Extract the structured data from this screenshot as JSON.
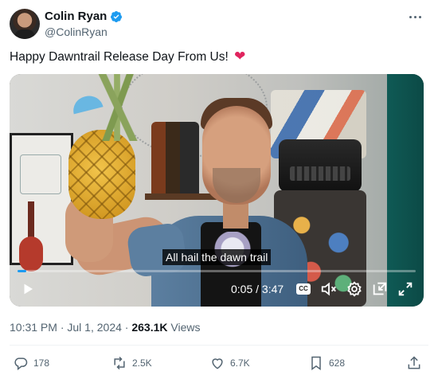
{
  "author": {
    "name": "Colin Ryan",
    "handle": "@ColinRyan",
    "verified": true
  },
  "tweet": {
    "text": "Happy Dawntrail Release Day From Us!",
    "emoji": "❤"
  },
  "video": {
    "caption": "All hail the dawn trail",
    "time_display": "0:05 / 3:47",
    "progress": 0.022,
    "cc_label": "CC",
    "controls": [
      "play-icon",
      "cc-icon",
      "mute-icon",
      "settings-icon",
      "picture-in-picture-icon",
      "fullscreen-icon"
    ]
  },
  "meta": {
    "time": "10:31 PM",
    "separator1": " · ",
    "date": "Jul 1, 2024",
    "separator2": " · ",
    "views_count": "263.1K",
    "views_label": " Views"
  },
  "actions": {
    "replies": "178",
    "reposts": "2.5K",
    "likes": "6.7K",
    "bookmarks": "628"
  },
  "colors": {
    "accent": "#1d9bf0",
    "text_secondary": "#536471",
    "heart": "#e0245e"
  }
}
